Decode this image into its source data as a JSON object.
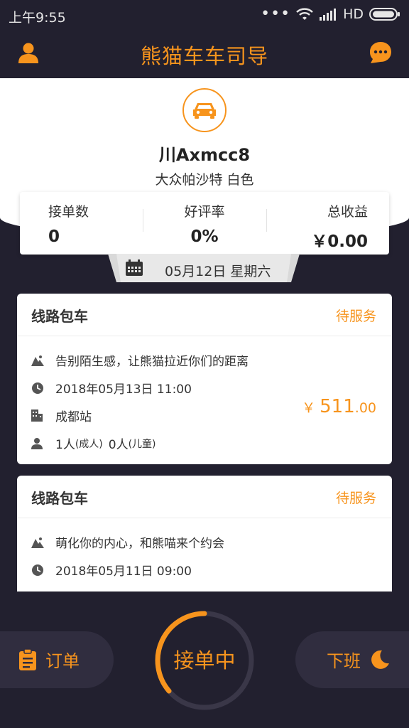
{
  "status_bar": {
    "time": "上午9:55",
    "dots": "•••",
    "network": "HD"
  },
  "header": {
    "title": "熊猫车车司导",
    "icons": [
      "user-icon",
      "chat-bubble-icon"
    ]
  },
  "profile": {
    "plate": "川Axmcc8",
    "model": "大众帕沙特 白色"
  },
  "stats": [
    {
      "label": "接单数",
      "value": "0"
    },
    {
      "label": "好评率",
      "value": "0%"
    },
    {
      "label": "总收益",
      "value": "￥0.00"
    }
  ],
  "date_tab": {
    "text": "05月12日 星期六"
  },
  "orders": [
    {
      "title": "线路包车",
      "status": "待服务",
      "route": "告别陌生感，让熊猫拉近你们的距离",
      "time": "2018年05月13日 11:00",
      "station": "成都站",
      "adults": "1人",
      "adults_note": "(成人)",
      "children": "0人",
      "children_note": "(儿童)",
      "currency": "￥",
      "price_int": "511",
      "price_dec": ".00"
    },
    {
      "title": "线路包车",
      "status": "待服务",
      "route": "萌化你的内心，和熊喵来个约会",
      "time": "2018年05月11日 09:00"
    }
  ],
  "bottom": {
    "orders_label": "订单",
    "center_label": "接单中",
    "offwork_label": "下班"
  },
  "colors": {
    "accent": "#f7941d",
    "background": "#22202f",
    "pill": "#302d3f"
  }
}
